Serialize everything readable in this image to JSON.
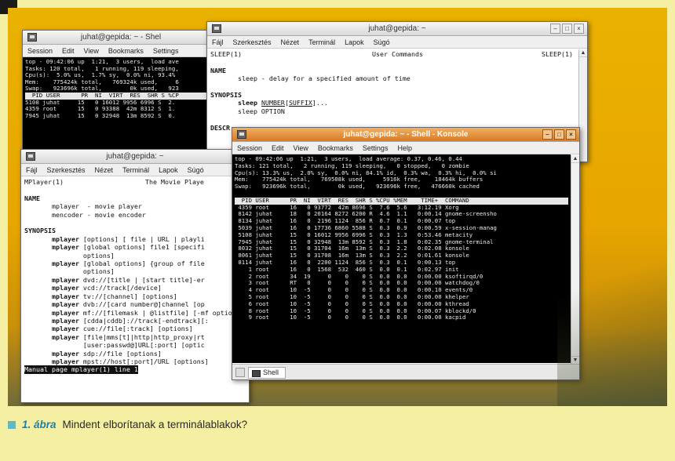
{
  "caption": {
    "number": "1. ábra",
    "text": "Mindent elborítanak a terminálablakok?"
  },
  "konsole_back": {
    "title": "juhat@gepida: ~ - Shel",
    "menu": [
      "Session",
      "Edit",
      "View",
      "Bookmarks",
      "Settings"
    ],
    "content": "top - 09:42:06 up  1:21,  3 users,  load ave\nTasks: 120 total,   1 running, 119 sleeping,\nCpu(s):  5.0% us,  1.7% sy,  0.0% ni, 93.4%\nMem:    775424k total,   769324k used,     6\nSwap:   923696k total,        0k used,   923",
    "header": "  PID USER      PR  NI  VIRT  RES  SHR S %CP",
    "rows": "5108 juhat     15   0 16012 9956 6996 S  2.\n4359 root      15   0 93388  42m 8312 S  1.\n7945 juhat     15   0 32948  13m 8592 S  0."
  },
  "man_sleep": {
    "title": "juhat@gepida: ~",
    "menu": [
      "Fájl",
      "Szerkesztés",
      "Nézet",
      "Terminál",
      "Lapok",
      "Súgó"
    ],
    "header_left": "SLEEP(1)",
    "header_center": "User Commands",
    "header_right": "SLEEP(1)",
    "name_heading": "NAME",
    "name_text": "       sleep - delay for a specified amount of time",
    "synopsis_heading": "SYNOPSIS",
    "synopsis_cmd": "sleep",
    "synopsis_arg1": "NUMBER",
    "synopsis_arg2": "SUFFIX",
    "synopsis_rest": "...",
    "synopsis_line2": "       sleep OPTION",
    "desc_heading": "DESCR"
  },
  "man_mplayer": {
    "title": "juhat@gepida: ~",
    "menu": [
      "Fájl",
      "Szerkesztés",
      "Nézet",
      "Terminál",
      "Lapok",
      "Súgó"
    ],
    "header_left": "MPlayer(1)",
    "header_center": "The Movie Playe",
    "name_heading": "NAME",
    "name_lines": "       mplayer  - movie player\n       mencoder - movie encoder",
    "synopsis_heading": "SYNOPSIS",
    "synopsis_lines": [
      {
        "cmd": "mplayer",
        "rest": "[options] [ file | URL | playli"
      },
      {
        "cmd": "mplayer",
        "rest": "[global options] file1 [specifi"
      },
      {
        "cmd": "",
        "rest": "options]"
      },
      {
        "cmd": "mplayer",
        "rest": "[global options] {group of file"
      },
      {
        "cmd": "",
        "rest": "options]"
      },
      {
        "cmd": "mplayer",
        "rest": "dvd://[title | [start title]-er"
      },
      {
        "cmd": "mplayer",
        "rest": "vcd://track[/device]"
      },
      {
        "cmd": "mplayer",
        "rest": "tv://[channel] [options]"
      },
      {
        "cmd": "mplayer",
        "rest": "dvb://[card number@]channel [op"
      },
      {
        "cmd": "mplayer",
        "rest": "mf://[filemask | @listfile] [-mf options] [op"
      },
      {
        "cmd": "mplayer",
        "rest": "[cdda|cddb]://track[-endtrack][:"
      },
      {
        "cmd": "mplayer",
        "rest": "cue://file[:track] [options]"
      },
      {
        "cmd": "mplayer",
        "rest": "[file|mms[t]|http|http_proxy|rt"
      },
      {
        "cmd": "",
        "rest": "[user:passwd@]URL[:port] [optic"
      },
      {
        "cmd": "mplayer",
        "rest": "sdp://file [options]"
      },
      {
        "cmd": "mplayer",
        "rest": "mpst://host[:port]/URL [options]"
      }
    ],
    "status": "Manual page mplayer(1) line 1"
  },
  "konsole_front": {
    "title": "juhat@gepida: ~ - Shell - Konsole",
    "menu": [
      "Session",
      "Edit",
      "View",
      "Bookmarks",
      "Settings",
      "Help"
    ],
    "summary": "top - 09:42:06 up  1:21,  3 users,  load average: 0.37, 0.46, 0.44\nTasks: 121 total,   2 running, 119 sleeping,   0 stopped,   0 zombie\nCpu(s): 13.3% us,  2.0% sy,  0.0% ni, 84.1% id,  0.3% wa,  0.3% hi,  0.0% si\nMem:    775424k total,   769508k used,     5916k free,    18464k buffers\nSwap:   923696k total,        0k used,   923696k free,   476660k cached",
    "table_header": "  PID USER      PR  NI  VIRT  RES  SHR S %CPU %MEM    TIME+  COMMAND",
    "rows": " 4359 root      16   0 93772  42m 8696 S  7.6  5.6   3:12.19 Xorg\n 8142 juhat     18   0 20164 8272 6200 R  4.6  1.1   0:00.14 gnome-screensho\n 8134 juhat     16   0  2196 1124  856 R  0.7  0.1   0:00.07 top\n 5039 juhat     16   0 17736 6860 5588 S  0.3  0.9   0:00.59 x-session-manag\n 5108 juhat     15   0 16012 9956 6996 S  0.3  1.3   0:53.46 metacity\n 7945 juhat     15   0 32948  13m 8592 S  0.3  1.8   0:02.35 gnome-terminal\n 8032 juhat     15   0 31704  16m  13m S  0.3  2.2   0:02.08 konsole\n 8061 juhat     15   0 31708  16m  13m S  0.3  2.2   0:01.61 konsole\n 8114 juhat     16   0  2200 1124  856 S  0.3  0.1   0:00.13 top\n    1 root      16   0  1568  532  460 S  0.0  0.1   0:02.97 init\n    2 root      34  19     0    0    0 S  0.0  0.0   0:00.00 ksoftirqd/0\n    3 root      RT   0     0    0    0 S  0.0  0.0   0:00.00 watchdog/0\n    4 root      10  -5     0    0    0 S  0.0  0.0   0:00.10 events/0\n    5 root      10  -5     0    0    0 S  0.0  0.0   0:00.00 khelper\n    6 root      10  -5     0    0    0 S  0.0  0.0   0:00.00 kthread\n    8 root      10  -5     0    0    0 S  0.0  0.0   0:00.07 kblockd/0\n    9 root      10  -5     0    0    0 S  0.0  0.0   0:00.00 kacpid",
    "tab_label": "Shell"
  },
  "colors": {
    "desktop": "#e8a500",
    "page": "#f4efa2",
    "caption_accent": "#60b9c4",
    "caption_number": "#1f7fa8"
  }
}
